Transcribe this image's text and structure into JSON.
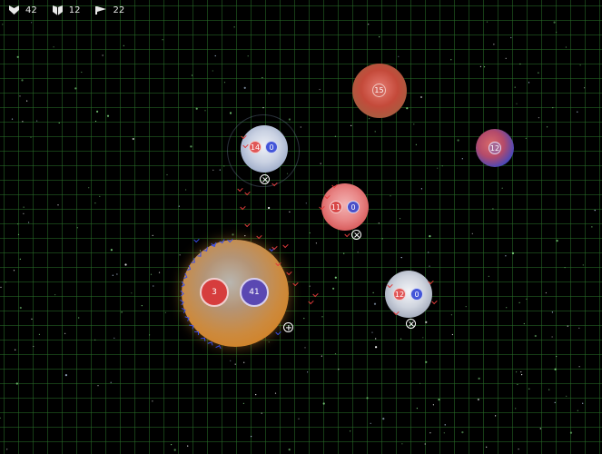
{
  "hud": {
    "lives": {
      "icon": "heart-icon",
      "value": "42"
    },
    "shields": {
      "icon": "shield-icon",
      "value": "12"
    },
    "flags": {
      "icon": "flag-icon",
      "value": "22"
    }
  },
  "colors": {
    "grid": "#286e28",
    "red_team": "#e23b3b",
    "blue_team": "#3a4de8",
    "neutral": "#c8ccd8"
  },
  "planets": [
    {
      "id": "gas-giant",
      "badges": [
        "3",
        "41"
      ]
    },
    {
      "id": "planet-top-center",
      "badges": [
        "14",
        "0"
      ]
    },
    {
      "id": "planet-red-top",
      "badges": [
        "15"
      ]
    },
    {
      "id": "planet-right",
      "badges": [
        "12"
      ]
    },
    {
      "id": "planet-center-pink",
      "badges": [
        "11",
        "0"
      ]
    },
    {
      "id": "planet-lower-right",
      "badges": [
        "12",
        "0"
      ]
    }
  ]
}
